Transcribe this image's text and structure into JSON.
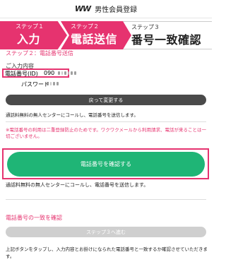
{
  "header": {
    "logo": "WW",
    "title": "男性会員登録"
  },
  "steps": [
    {
      "num": "ステップ１",
      "title": "入力"
    },
    {
      "num": "ステップ２",
      "title": "電話送信"
    },
    {
      "num": "ステップ３",
      "title": "番号一致確認"
    }
  ],
  "step2_section": {
    "title": "ステップ２：電話番号送信"
  },
  "input_contents": {
    "heading": "ご入力内容",
    "phone_label": "電話番号(ID)",
    "phone_value_prefix": "090",
    "password_label": "パスワード"
  },
  "back_button": {
    "label": "戻って変更する"
  },
  "note_toll_free_1": "通話料無料の無人センターにコールし、電話番号を送信します。",
  "warning": "※電話番号の利用は二重登録防止のためです。ワクワクメールから利用請求、電話が来ることは一切ございません。",
  "confirm_button": {
    "label": "電話番号を確認する"
  },
  "note_toll_free_2": "通話料無料の無人センターにコールし、電話番号を送信します。",
  "step3_section": {
    "title": "電話番号の一致を確認"
  },
  "next_button": {
    "label": "ステップ３へ進む"
  },
  "bottom_note": "上記ボタンをタップし、入力内容とお掛けになられた電話番号と一致するか確認させていただきます。",
  "colors": {
    "accent": "#e6336f",
    "green": "#1fb576",
    "dark_button": "#4a4a4a",
    "disabled_button": "#cfcfcf"
  }
}
